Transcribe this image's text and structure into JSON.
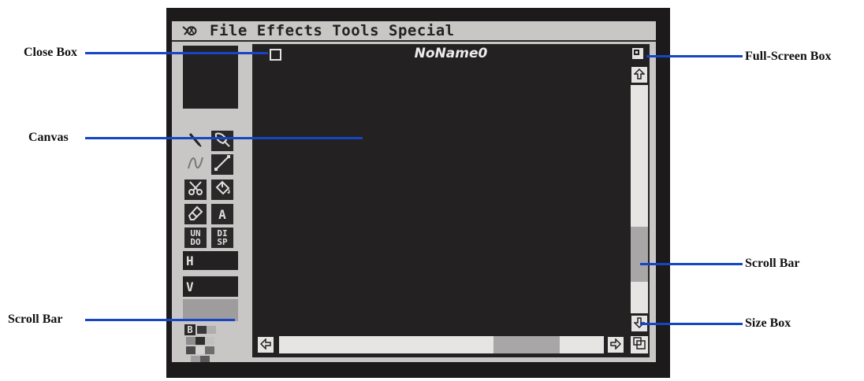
{
  "menu": {
    "items": [
      "File",
      "Effects",
      "Tools",
      "Special"
    ]
  },
  "window": {
    "title": "NoName0"
  },
  "tools": {
    "undo_label": "UN\nDO",
    "disp_label": "DI\nSP",
    "text_tool_label": "A",
    "h_label": "H",
    "v_label": "V",
    "b_label": "B"
  },
  "scrollbars": {
    "vertical_position_fraction": 0.82,
    "horizontal_position_fraction": 0.83
  },
  "callouts": {
    "close_box": "Close Box",
    "canvas": "Canvas",
    "scroll_bar_left": "Scroll Bar",
    "full_screen_box": "Full-Screen Box",
    "scroll_bar_right": "Scroll Bar",
    "size_box": "Size Box"
  },
  "colors": {
    "line": "#1646c3",
    "window_bg": "#232122",
    "desktop": "#c9c7c6"
  }
}
